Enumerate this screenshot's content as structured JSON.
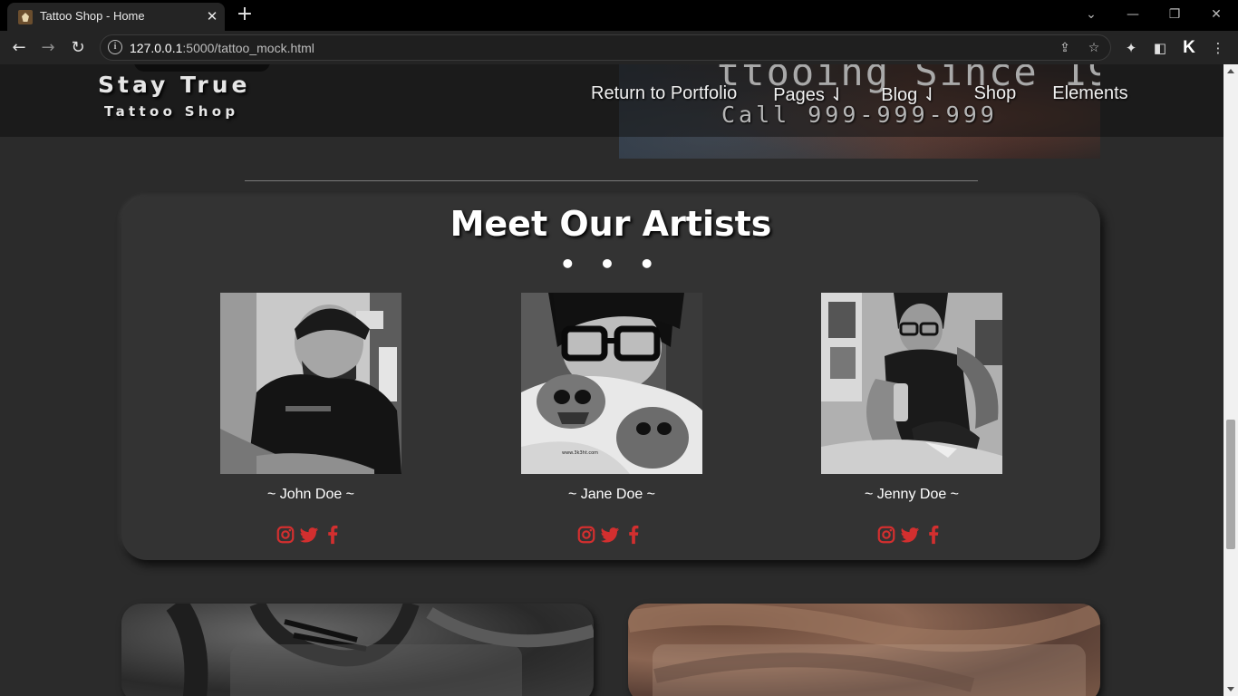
{
  "browser": {
    "tab_title": "Tattoo Shop - Home",
    "url_host": "127.0.0.1",
    "url_rest": ":5000/tattoo_mock.html"
  },
  "site": {
    "logo_title": "Stay True",
    "logo_subtitle": "Tattoo Shop",
    "hero_line1": "ttooing Since 19",
    "hero_line2": "Call 999-999-999",
    "nav": [
      "Return to Portfolio",
      "Pages ⇃",
      "Blog ⇃",
      "Shop",
      "Elements"
    ]
  },
  "artists_section": {
    "title": "Meet Our Artists",
    "dots": "• • •",
    "artists": [
      {
        "name": "~ John Doe ~"
      },
      {
        "name": "~ Jane Doe ~"
      },
      {
        "name": "~ Jenny Doe ~"
      }
    ],
    "social_color": "#d32f2f"
  },
  "icons": [
    "instagram-icon",
    "twitter-icon",
    "facebook-icon"
  ]
}
